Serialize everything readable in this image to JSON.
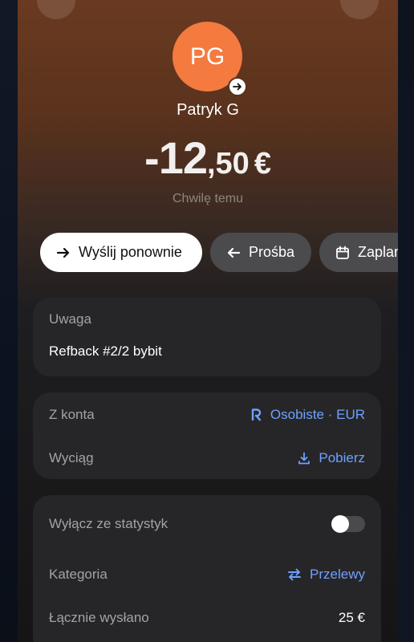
{
  "contact": {
    "initials": "PG",
    "name": "Patryk G"
  },
  "transaction": {
    "amount_int": "-12",
    "amount_dec": ",50",
    "currency": "€",
    "time": "Chwilę temu"
  },
  "actions": [
    {
      "label": "Wyślij ponownie",
      "icon": "arrow-right-icon"
    },
    {
      "label": "Prośba",
      "icon": "arrow-left-icon"
    },
    {
      "label": "Zaplanuj",
      "icon": "calendar-icon"
    }
  ],
  "note": {
    "label": "Uwaga",
    "text": "Refback #2/2 bybit"
  },
  "account": {
    "from_label": "Z konta",
    "from_value": "Osobiste · EUR",
    "from_icon": "revolut-r-icon",
    "statement_label": "Wyciąg",
    "statement_value": "Pobierz",
    "statement_icon": "download-icon"
  },
  "details": {
    "exclude_label": "Wyłącz ze statystyk",
    "exclude_enabled": false,
    "category_label": "Kategoria",
    "category_value": "Przelewy",
    "category_icon": "swap-arrows-icon",
    "total_label": "Łącznie wysłano",
    "total_value": "25 €"
  },
  "colors": {
    "avatar": "#f47a3f",
    "link": "#6fa0ff",
    "card": "#262628",
    "header_top": "#6a3a20"
  }
}
